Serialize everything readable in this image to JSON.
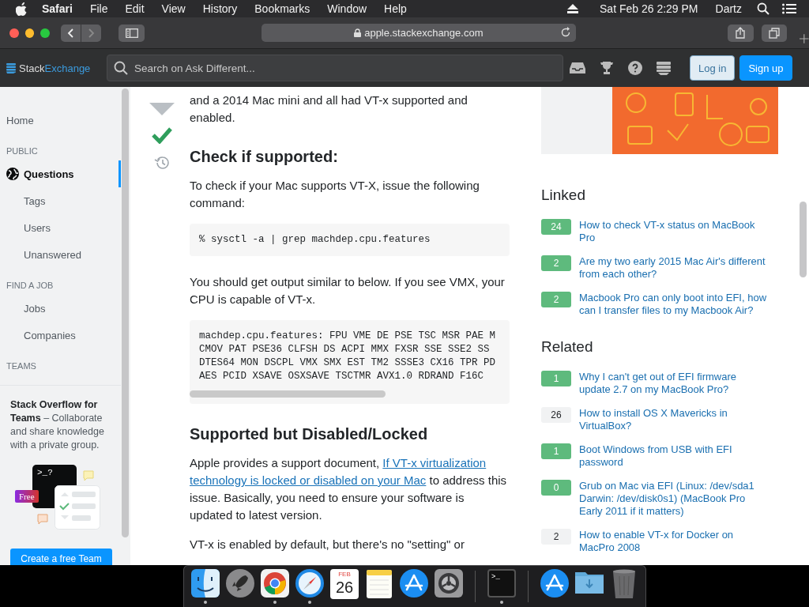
{
  "menu_bar": {
    "app": "Safari",
    "menus": [
      "File",
      "Edit",
      "View",
      "History",
      "Bookmarks",
      "Window",
      "Help"
    ],
    "clock": "Sat Feb 26  2:29 PM",
    "user": "Dartz"
  },
  "browser": {
    "address": "apple.stackexchange.com",
    "can_go_forward": false
  },
  "site_header": {
    "logo_first": "Stack",
    "logo_second": "Exchange",
    "search_placeholder": "Search on Ask Different...",
    "login": "Log in",
    "signup": "Sign up"
  },
  "sidebar": {
    "items": [
      {
        "kind": "link",
        "label": "Home",
        "selected": false
      },
      {
        "kind": "heading",
        "label": "PUBLIC"
      },
      {
        "kind": "main",
        "label": "Questions",
        "selected": true
      },
      {
        "kind": "sub",
        "label": "Tags",
        "selected": false
      },
      {
        "kind": "sub",
        "label": "Users",
        "selected": false
      },
      {
        "kind": "sub",
        "label": "Unanswered",
        "selected": false
      },
      {
        "kind": "heading",
        "label": "FIND A JOB"
      },
      {
        "kind": "sub",
        "label": "Jobs",
        "selected": false
      },
      {
        "kind": "sub",
        "label": "Companies",
        "selected": false
      },
      {
        "kind": "heading",
        "label": "TEAMS"
      }
    ],
    "teams_promo": {
      "text": "**Stack Overflow for Teams** – Collaborate and share knowledge with a private group.",
      "prompt": ">_?",
      "badge": "Free",
      "button": "Create a free Team"
    }
  },
  "answer": {
    "accepted": true,
    "blocks": [
      {
        "kind": "paragraph",
        "parts": [
          {
            "text": "and a 2014 Mac mini and all had VT-x supported and enabled."
          }
        ]
      },
      {
        "kind": "heading",
        "text": "Check if supported:"
      },
      {
        "kind": "paragraph",
        "parts": [
          {
            "text": "To check if your Mac supports VT-X, issue the following command:"
          }
        ]
      },
      {
        "kind": "code",
        "lines": [
          "% sysctl -a | grep machdep.cpu.features"
        ]
      },
      {
        "kind": "paragraph",
        "parts": [
          {
            "text": "You should get output similar to below. If you see VMX, your CPU is capable of VT-x."
          }
        ]
      },
      {
        "kind": "code",
        "scrollbar": true,
        "lines": [
          "machdep.cpu.features: FPU VME DE PSE TSC MSR PAE M",
          "CMOV PAT PSE36 CLFSH DS ACPI MMX FXSR SSE SSE2 SS",
          "DTES64 MON DSCPL VMX SMX EST TM2 SSSE3 CX16 TPR PD",
          "AES PCID XSAVE OSXSAVE TSCTMR AVX1.0 RDRAND F16C"
        ]
      },
      {
        "kind": "heading",
        "text": "Supported but Disabled/Locked"
      },
      {
        "kind": "paragraph",
        "parts": [
          {
            "text": "Apple provides a support document, "
          },
          {
            "text": "If VT-x virtualization",
            "link": true
          },
          {
            "text": "technology is locked or disabled on your Mac",
            "link": true
          },
          {
            "text": " to address this issue. Basically, you need to ensure your software is updated to latest version."
          }
        ]
      },
      {
        "kind": "paragraph",
        "parts": [
          {
            "text": "VT-x is enabled by default, but there's no \"setting\" or"
          }
        ]
      }
    ]
  },
  "right_column": {
    "sections": [
      {
        "title": "Linked",
        "items": [
          {
            "score": "24",
            "answered": true,
            "title": "How to check VT-x status on MacBook Pro"
          },
          {
            "score": "2",
            "answered": true,
            "title": "Are my two early 2015 Mac Air's different from each other?"
          },
          {
            "score": "2",
            "answered": true,
            "title": "Macbook Pro can only boot into EFI, how can I transfer files to my Macbook Air?"
          }
        ]
      },
      {
        "title": "Related",
        "items": [
          {
            "score": "1",
            "answered": true,
            "title": "Why I can't get out of EFI firmware update 2.7 on my MacBook Pro?"
          },
          {
            "score": "26",
            "answered": false,
            "title": "How to install OS X Mavericks in VirtualBox?"
          },
          {
            "score": "1",
            "answered": true,
            "title": "Boot Windows from USB with EFI password"
          },
          {
            "score": "0",
            "answered": true,
            "title": "Grub on Mac via EFI (Linux: /dev/sda1 Darwin: /dev/disk0s1) (MacBook Pro Early 2011 if it matters)"
          },
          {
            "score": "2",
            "answered": false,
            "title": "How to enable VT-x for Docker on MacPro 2008"
          }
        ]
      }
    ]
  },
  "dock": {
    "items": [
      {
        "kind": "finder",
        "running": true
      },
      {
        "kind": "rocket",
        "running": false
      },
      {
        "kind": "chrome",
        "running": true
      },
      {
        "kind": "compass",
        "running": true
      },
      {
        "kind": "calendar",
        "month": "FEB",
        "day": "26",
        "running": false
      },
      {
        "kind": "notes",
        "running": false
      },
      {
        "kind": "appstore",
        "running": false
      },
      {
        "kind": "settings",
        "running": false
      },
      {
        "kind": "separator"
      },
      {
        "kind": "terminal",
        "prompt": ">_",
        "running": true
      },
      {
        "kind": "separator"
      },
      {
        "kind": "appstore",
        "running": false
      },
      {
        "kind": "downloads",
        "running": false
      },
      {
        "kind": "trash",
        "running": false
      }
    ]
  }
}
